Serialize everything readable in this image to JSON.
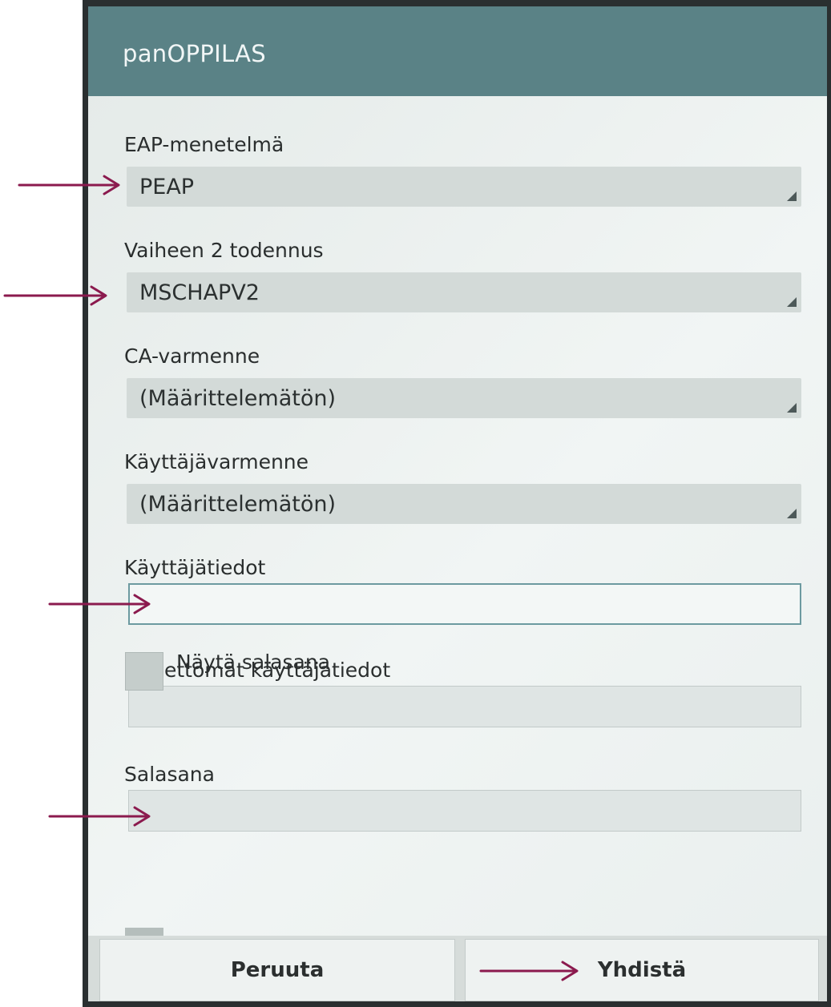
{
  "dialog": {
    "title": "panOPPILAS"
  },
  "form": {
    "eap_method": {
      "label": "EAP-menetelmä",
      "value": "PEAP"
    },
    "phase2": {
      "label": "Vaiheen 2 todennus",
      "value": "MSCHAPV2"
    },
    "ca_cert": {
      "label": "CA-varmenne",
      "value": "(Määrittelemätön)"
    },
    "user_cert": {
      "label": "Käyttäjävarmenne",
      "value": "(Määrittelemätön)"
    },
    "identity": {
      "label": "Käyttäjätiedot",
      "value": ""
    },
    "anonymous_identity": {
      "label": "Nimettömät käyttäjätiedot",
      "value": ""
    },
    "password": {
      "label": "Salasana",
      "value": ""
    },
    "show_password": {
      "label": "Näytä salasana",
      "checked": false
    }
  },
  "buttons": {
    "cancel": "Peruuta",
    "connect": "Yhdistä"
  },
  "annotation": {
    "arrow_color": "#8b1a4e"
  }
}
